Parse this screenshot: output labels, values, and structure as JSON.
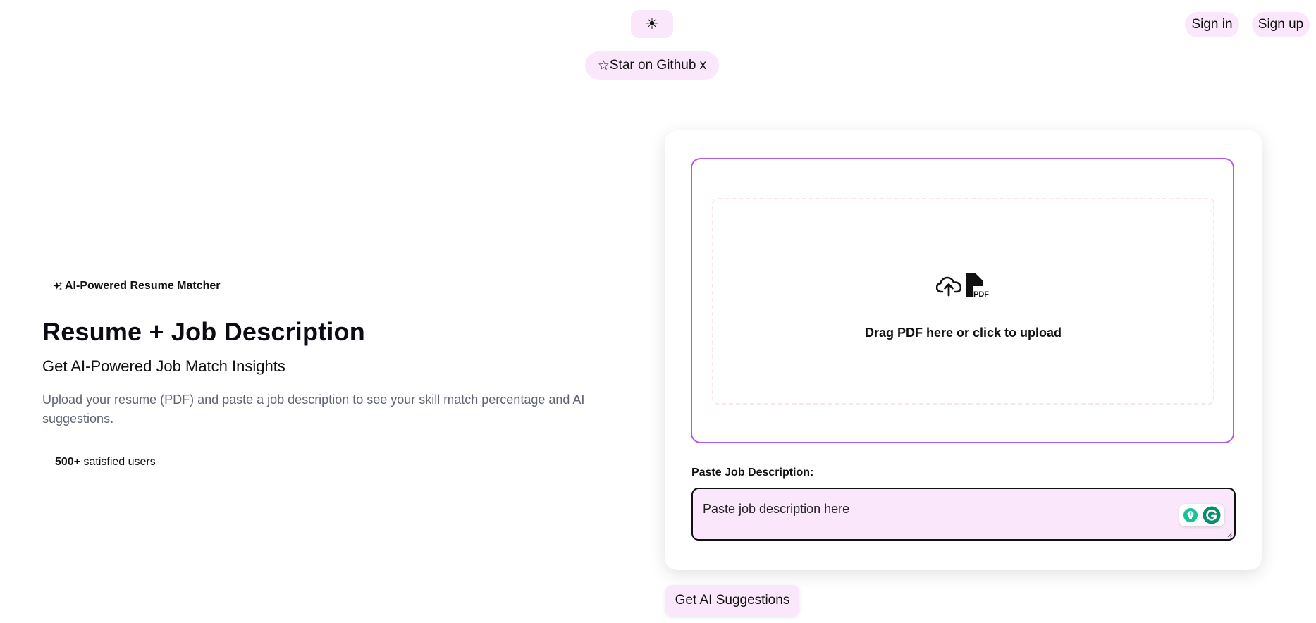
{
  "header": {
    "theme_toggle_icon": "☀",
    "star_github_label": "Star on Github x",
    "star_icon": "☆",
    "sign_in_label": "Sign in",
    "sign_up_label": "Sign up"
  },
  "hero": {
    "badge_label": "AI-Powered Resume Matcher",
    "badge_icon": "sparkles-icon",
    "title": "Resume + Job Description",
    "subtitle": "Get AI-Powered Job Match Insights",
    "description": "Upload your resume (PDF) and paste a job description to see your skill match percentage and AI suggestions.",
    "users_count": "500+",
    "users_suffix": " satisfied users"
  },
  "upload": {
    "text": "Drag PDF here or click to upload",
    "icons": [
      "cloud-upload-icon",
      "pdf-file-icon"
    ],
    "pdf_label": "PDF"
  },
  "job_description": {
    "label": "Paste Job Description:",
    "placeholder": "Paste job description here",
    "value": ""
  },
  "actions": {
    "get_suggestions_label": "Get AI Suggestions"
  },
  "colors": {
    "pill_bg": "#fbe7fb",
    "upload_border": "#b45ae8",
    "grammarly_green": "#15c39a",
    "grammarly_dark": "#0e8c6f"
  }
}
